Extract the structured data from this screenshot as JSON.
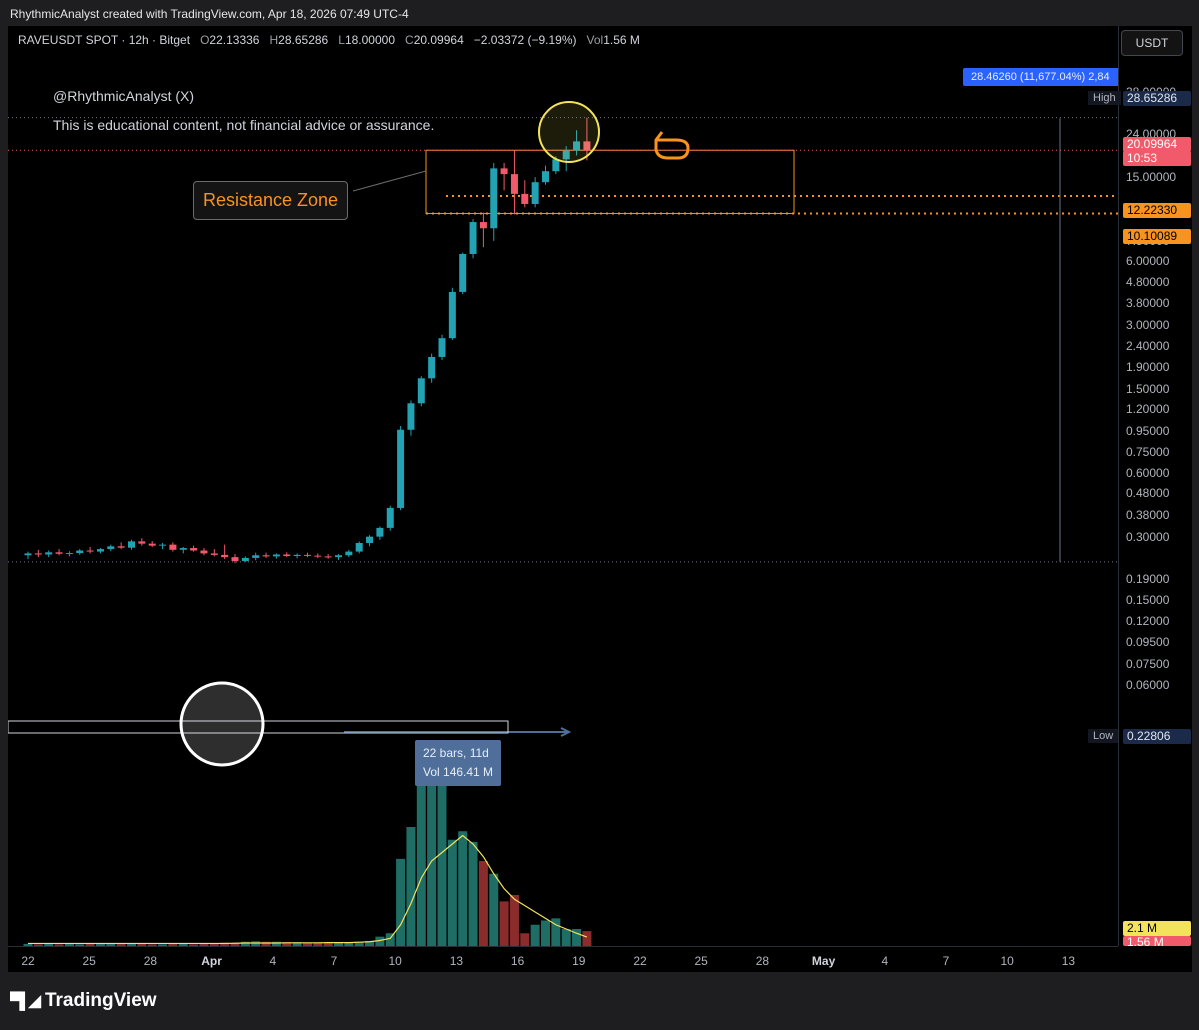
{
  "header": {
    "text": "RhythmicAnalyst created with TradingView.com, Apr 18, 2026 07:49 UTC-4"
  },
  "symbol": {
    "title": "RAVEUSDT SPOT · 12h · Bitget",
    "o_label": "O",
    "o": "22.13336",
    "h_label": "H",
    "h": "28.65286",
    "l_label": "L",
    "l": "18.00000",
    "c_label": "C",
    "c": "20.09964",
    "change": "−2.03372 (−9.19%)",
    "vol_label": "Vol",
    "vol": "1.56 M"
  },
  "notes": {
    "author": "@RhythmicAnalyst (X)",
    "disclaimer": "This is educational content, not financial advice or assurance.",
    "resistance": "Resistance Zone",
    "measure_bars": "22 bars, 11d",
    "measure_vol": "Vol 146.41 M",
    "measure_pct": "28.46260 (11,677.04%) 2,84"
  },
  "axis": {
    "unit": "USDT",
    "price_ticks": [
      "38.00000",
      "24.00000",
      "15.00000",
      "7.50000",
      "6.00000",
      "4.80000",
      "3.80000",
      "3.00000",
      "2.40000",
      "1.90000",
      "1.50000",
      "1.20000",
      "0.95000",
      "0.75000",
      "0.60000",
      "0.48000",
      "0.38000",
      "0.30000",
      "0.19000",
      "0.15000",
      "0.12000",
      "0.09500",
      "0.07500",
      "0.06000"
    ],
    "tags": {
      "high_label": "High",
      "high": "28.65286",
      "close": "20.09964",
      "countdown": "10:53",
      "level1": "12.22330",
      "level2": "10.10089",
      "low_label": "Low",
      "low": "0.22806",
      "vol_ma": "2.1 M",
      "vol": "1.56 M"
    },
    "x_ticks": [
      "22",
      "25",
      "28",
      "Apr",
      "4",
      "7",
      "10",
      "13",
      "16",
      "19",
      "22",
      "25",
      "28",
      "May",
      "4",
      "7",
      "10",
      "13"
    ]
  },
  "colors": {
    "up": "#22a2b3",
    "down": "#f05a6a",
    "zone": "#f7931e",
    "vol_up": "#1f6e66",
    "vol_down": "#8b2c2c",
    "vol_ma": "#f2e35a"
  },
  "chart_data": {
    "type": "candlestick",
    "scale": "log",
    "ylim": [
      0.06,
      38
    ],
    "candles_ohlc": [
      [
        0.245,
        0.255,
        0.235,
        0.25
      ],
      [
        0.25,
        0.26,
        0.24,
        0.247
      ],
      [
        0.247,
        0.258,
        0.24,
        0.253
      ],
      [
        0.253,
        0.262,
        0.245,
        0.249
      ],
      [
        0.249,
        0.256,
        0.242,
        0.251
      ],
      [
        0.251,
        0.262,
        0.246,
        0.258
      ],
      [
        0.258,
        0.268,
        0.25,
        0.255
      ],
      [
        0.255,
        0.265,
        0.25,
        0.262
      ],
      [
        0.262,
        0.275,
        0.256,
        0.27
      ],
      [
        0.27,
        0.282,
        0.262,
        0.266
      ],
      [
        0.266,
        0.29,
        0.26,
        0.285
      ],
      [
        0.285,
        0.295,
        0.272,
        0.278
      ],
      [
        0.278,
        0.286,
        0.268,
        0.272
      ],
      [
        0.272,
        0.28,
        0.262,
        0.275
      ],
      [
        0.275,
        0.282,
        0.255,
        0.26
      ],
      [
        0.26,
        0.268,
        0.25,
        0.265
      ],
      [
        0.265,
        0.272,
        0.255,
        0.258
      ],
      [
        0.258,
        0.265,
        0.245,
        0.25
      ],
      [
        0.25,
        0.262,
        0.242,
        0.246
      ],
      [
        0.246,
        0.275,
        0.235,
        0.24
      ],
      [
        0.24,
        0.248,
        0.225,
        0.23
      ],
      [
        0.23,
        0.242,
        0.228,
        0.238
      ],
      [
        0.238,
        0.252,
        0.232,
        0.245
      ],
      [
        0.245,
        0.252,
        0.238,
        0.242
      ],
      [
        0.242,
        0.25,
        0.236,
        0.247
      ],
      [
        0.247,
        0.253,
        0.24,
        0.243
      ],
      [
        0.243,
        0.25,
        0.237,
        0.246
      ],
      [
        0.246,
        0.252,
        0.24,
        0.244
      ],
      [
        0.244,
        0.25,
        0.238,
        0.242
      ],
      [
        0.242,
        0.248,
        0.236,
        0.24
      ],
      [
        0.24,
        0.248,
        0.233,
        0.245
      ],
      [
        0.245,
        0.26,
        0.24,
        0.255
      ],
      [
        0.255,
        0.285,
        0.25,
        0.28
      ],
      [
        0.28,
        0.305,
        0.27,
        0.3
      ],
      [
        0.3,
        0.335,
        0.29,
        0.33
      ],
      [
        0.33,
        0.42,
        0.32,
        0.41
      ],
      [
        0.41,
        1.0,
        0.4,
        0.96
      ],
      [
        0.96,
        1.32,
        0.9,
        1.28
      ],
      [
        1.28,
        1.72,
        1.24,
        1.68
      ],
      [
        1.68,
        2.2,
        1.6,
        2.12
      ],
      [
        2.12,
        2.7,
        2.05,
        2.6
      ],
      [
        2.6,
        4.5,
        2.55,
        4.3
      ],
      [
        4.3,
        6.6,
        4.2,
        6.5
      ],
      [
        6.5,
        9.5,
        6.2,
        9.2
      ],
      [
        9.2,
        10.2,
        7.0,
        8.6
      ],
      [
        8.6,
        17.5,
        7.5,
        16.5
      ],
      [
        16.5,
        17.5,
        13.0,
        15.5
      ],
      [
        15.5,
        20.0,
        10.0,
        12.5
      ],
      [
        12.5,
        14.5,
        10.8,
        11.2
      ],
      [
        11.2,
        15.0,
        10.8,
        14.2
      ],
      [
        14.2,
        17.0,
        13.8,
        16.0
      ],
      [
        16.0,
        18.8,
        15.5,
        18.2
      ],
      [
        18.2,
        21.0,
        16.0,
        20.0
      ],
      [
        20.0,
        25.0,
        19.0,
        22.13
      ],
      [
        22.13,
        28.65,
        18.0,
        20.09964
      ]
    ],
    "volume_millions": [
      0.5,
      0.4,
      0.5,
      0.4,
      0.5,
      0.4,
      0.5,
      0.6,
      0.5,
      0.5,
      0.6,
      0.5,
      0.4,
      0.4,
      0.6,
      0.5,
      0.4,
      0.5,
      0.6,
      0.8,
      0.7,
      1.0,
      1.1,
      1.0,
      1.0,
      0.9,
      0.9,
      0.8,
      0.8,
      0.8,
      0.7,
      0.8,
      1.0,
      1.2,
      2.2,
      3.0,
      20.5,
      28.0,
      38.0,
      42.0,
      40.0,
      25.0,
      27.0,
      24.5,
      20.0,
      17.0,
      10.5,
      12.0,
      3.0,
      5.0,
      6.0,
      6.5,
      4.0,
      4.0,
      3.5
    ],
    "volume_ma_millions": [
      0.6,
      0.6,
      0.6,
      0.6,
      0.6,
      0.6,
      0.6,
      0.6,
      0.6,
      0.6,
      0.6,
      0.6,
      0.6,
      0.6,
      0.6,
      0.6,
      0.6,
      0.6,
      0.6,
      0.6,
      0.65,
      0.7,
      0.7,
      0.7,
      0.7,
      0.75,
      0.75,
      0.75,
      0.75,
      0.8,
      0.8,
      0.8,
      0.9,
      1.0,
      1.3,
      1.8,
      5.0,
      10.0,
      16.0,
      20.0,
      22.0,
      24.0,
      26.0,
      24.0,
      21.0,
      17.0,
      13.5,
      11.0,
      9.5,
      8.0,
      6.5,
      5.0,
      4.0,
      3.0,
      2.1
    ],
    "annotations": {
      "resistance_zone": [
        10.10089,
        20.09964
      ],
      "levels": [
        20.09964,
        12.2233,
        10.10089,
        0.22806,
        28.65286
      ],
      "measure": {
        "from": 0.22806,
        "to": 28.4626,
        "bars": 22,
        "days": 11
      }
    }
  }
}
